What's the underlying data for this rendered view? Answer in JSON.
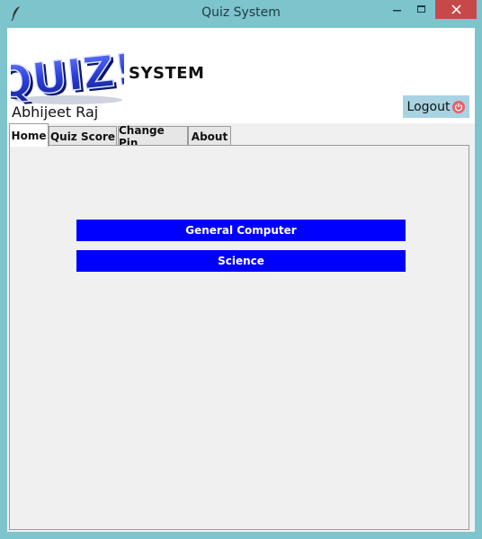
{
  "window": {
    "title": "Quiz System",
    "icon": "feather-icon",
    "frame_color": "#7ec4cc",
    "close_color": "#c74848"
  },
  "header": {
    "logo_text": "QUIZ!",
    "logo_subtitle": "SYSTEM",
    "user_name": "Abhijeet Raj",
    "logout_label": "Logout",
    "logout_icon": "power-icon",
    "logout_bg": "#a8d3e2"
  },
  "tabs": [
    {
      "label": "Home",
      "active": true
    },
    {
      "label": "Quiz Score",
      "active": false
    },
    {
      "label": "Change Pin",
      "active": false
    },
    {
      "label": "About",
      "active": false
    }
  ],
  "home": {
    "quiz_buttons": [
      {
        "label": "General Computer"
      },
      {
        "label": "Science"
      }
    ],
    "button_color": "#0000ff"
  }
}
